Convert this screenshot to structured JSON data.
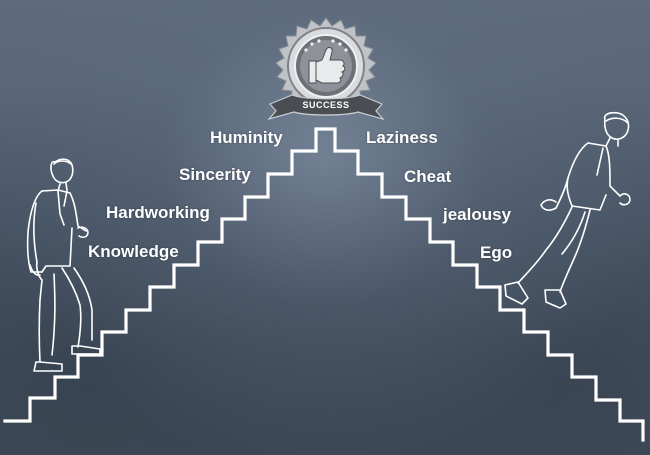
{
  "badge": {
    "label": "SUCCESS"
  },
  "left_words": [
    "Huminity",
    "Sincerity",
    "Hardworking",
    "Knowledge"
  ],
  "right_words": [
    "Laziness",
    "Cheat",
    "jealousy",
    "Ego"
  ],
  "colors": {
    "chalkboard": "#536173",
    "chalk": "#ffffff",
    "badge_silver": "#c9ccd0",
    "badge_ribbon": "#4a4d52"
  }
}
